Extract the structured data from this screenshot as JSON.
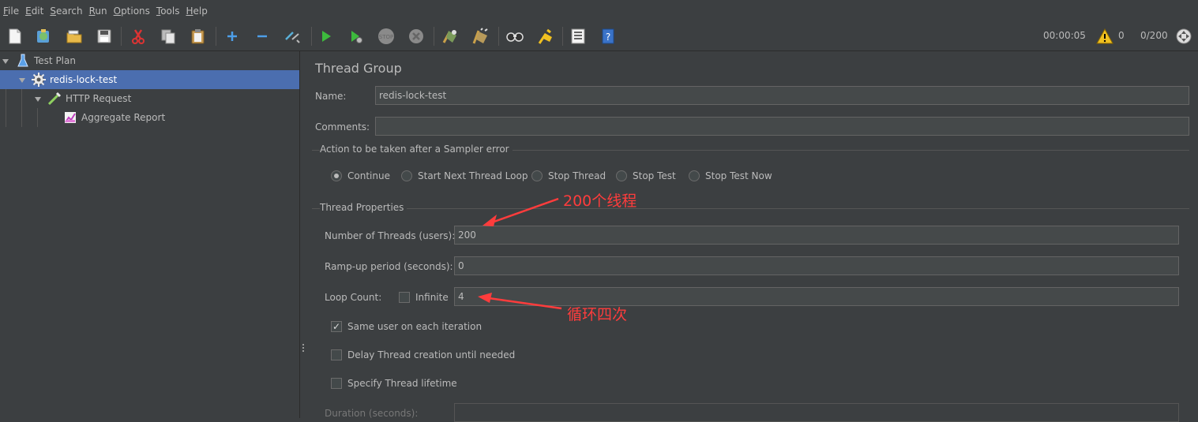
{
  "menu": {
    "items": [
      {
        "mnemonic": "F",
        "rest": "ile"
      },
      {
        "mnemonic": "E",
        "rest": "dit"
      },
      {
        "mnemonic": "S",
        "rest": "earch"
      },
      {
        "mnemonic": "R",
        "rest": "un"
      },
      {
        "mnemonic": "O",
        "rest": "ptions"
      },
      {
        "mnemonic": "T",
        "rest": "ools"
      },
      {
        "mnemonic": "H",
        "rest": "elp"
      }
    ]
  },
  "toolbar": {
    "elapsed_time": "00:00:05",
    "warning_count": "0",
    "thread_count": "0/200",
    "icons": [
      "new-icon",
      "templates-icon",
      "open-icon",
      "save-icon",
      "cut-icon",
      "copy-icon",
      "paste-icon",
      "expand-icon",
      "collapse-icon",
      "toggle-icon",
      "start-icon",
      "start-no-pause-icon",
      "stop-icon",
      "shutdown-icon",
      "clear-icon",
      "clear-all-icon",
      "search-icon",
      "reset-search-icon",
      "function-helper-icon",
      "help-icon",
      "remote-icon"
    ]
  },
  "tree": {
    "items": [
      {
        "label": "Test Plan",
        "icon": "test-plan-icon"
      },
      {
        "label": "redis-lock-test",
        "icon": "thread-group-gear-icon"
      },
      {
        "label": "HTTP Request",
        "icon": "sampler-pipette-icon"
      },
      {
        "label": "Aggregate Report",
        "icon": "report-chart-icon"
      }
    ]
  },
  "panel": {
    "title": "Thread Group",
    "name_label": "Name:",
    "name_value": "redis-lock-test",
    "comments_label": "Comments:",
    "comments_value": "",
    "error_action": {
      "title": "Action to be taken after a Sampler error",
      "options": [
        "Continue",
        "Start Next Thread Loop",
        "Stop Thread",
        "Stop Test",
        "Stop Test Now"
      ],
      "selected": "Continue"
    },
    "thread_props": {
      "title": "Thread Properties",
      "threads_label": "Number of Threads (users):",
      "threads_value": "200",
      "rampup_label": "Ramp-up period (seconds):",
      "rampup_value": "0",
      "loop_label": "Loop Count:",
      "infinite_label": "Infinite",
      "loop_value": "4",
      "same_user_label": "Same user on each iteration",
      "delay_label": "Delay Thread creation until needed",
      "lifetime_label": "Specify Thread lifetime",
      "duration_label": "Duration (seconds):"
    },
    "annotations": {
      "threads_note": "200个线程",
      "loop_note": "循环四次"
    },
    "colors": {
      "selection": "#4b6eaf",
      "annotation": "#ff3c3c"
    }
  }
}
